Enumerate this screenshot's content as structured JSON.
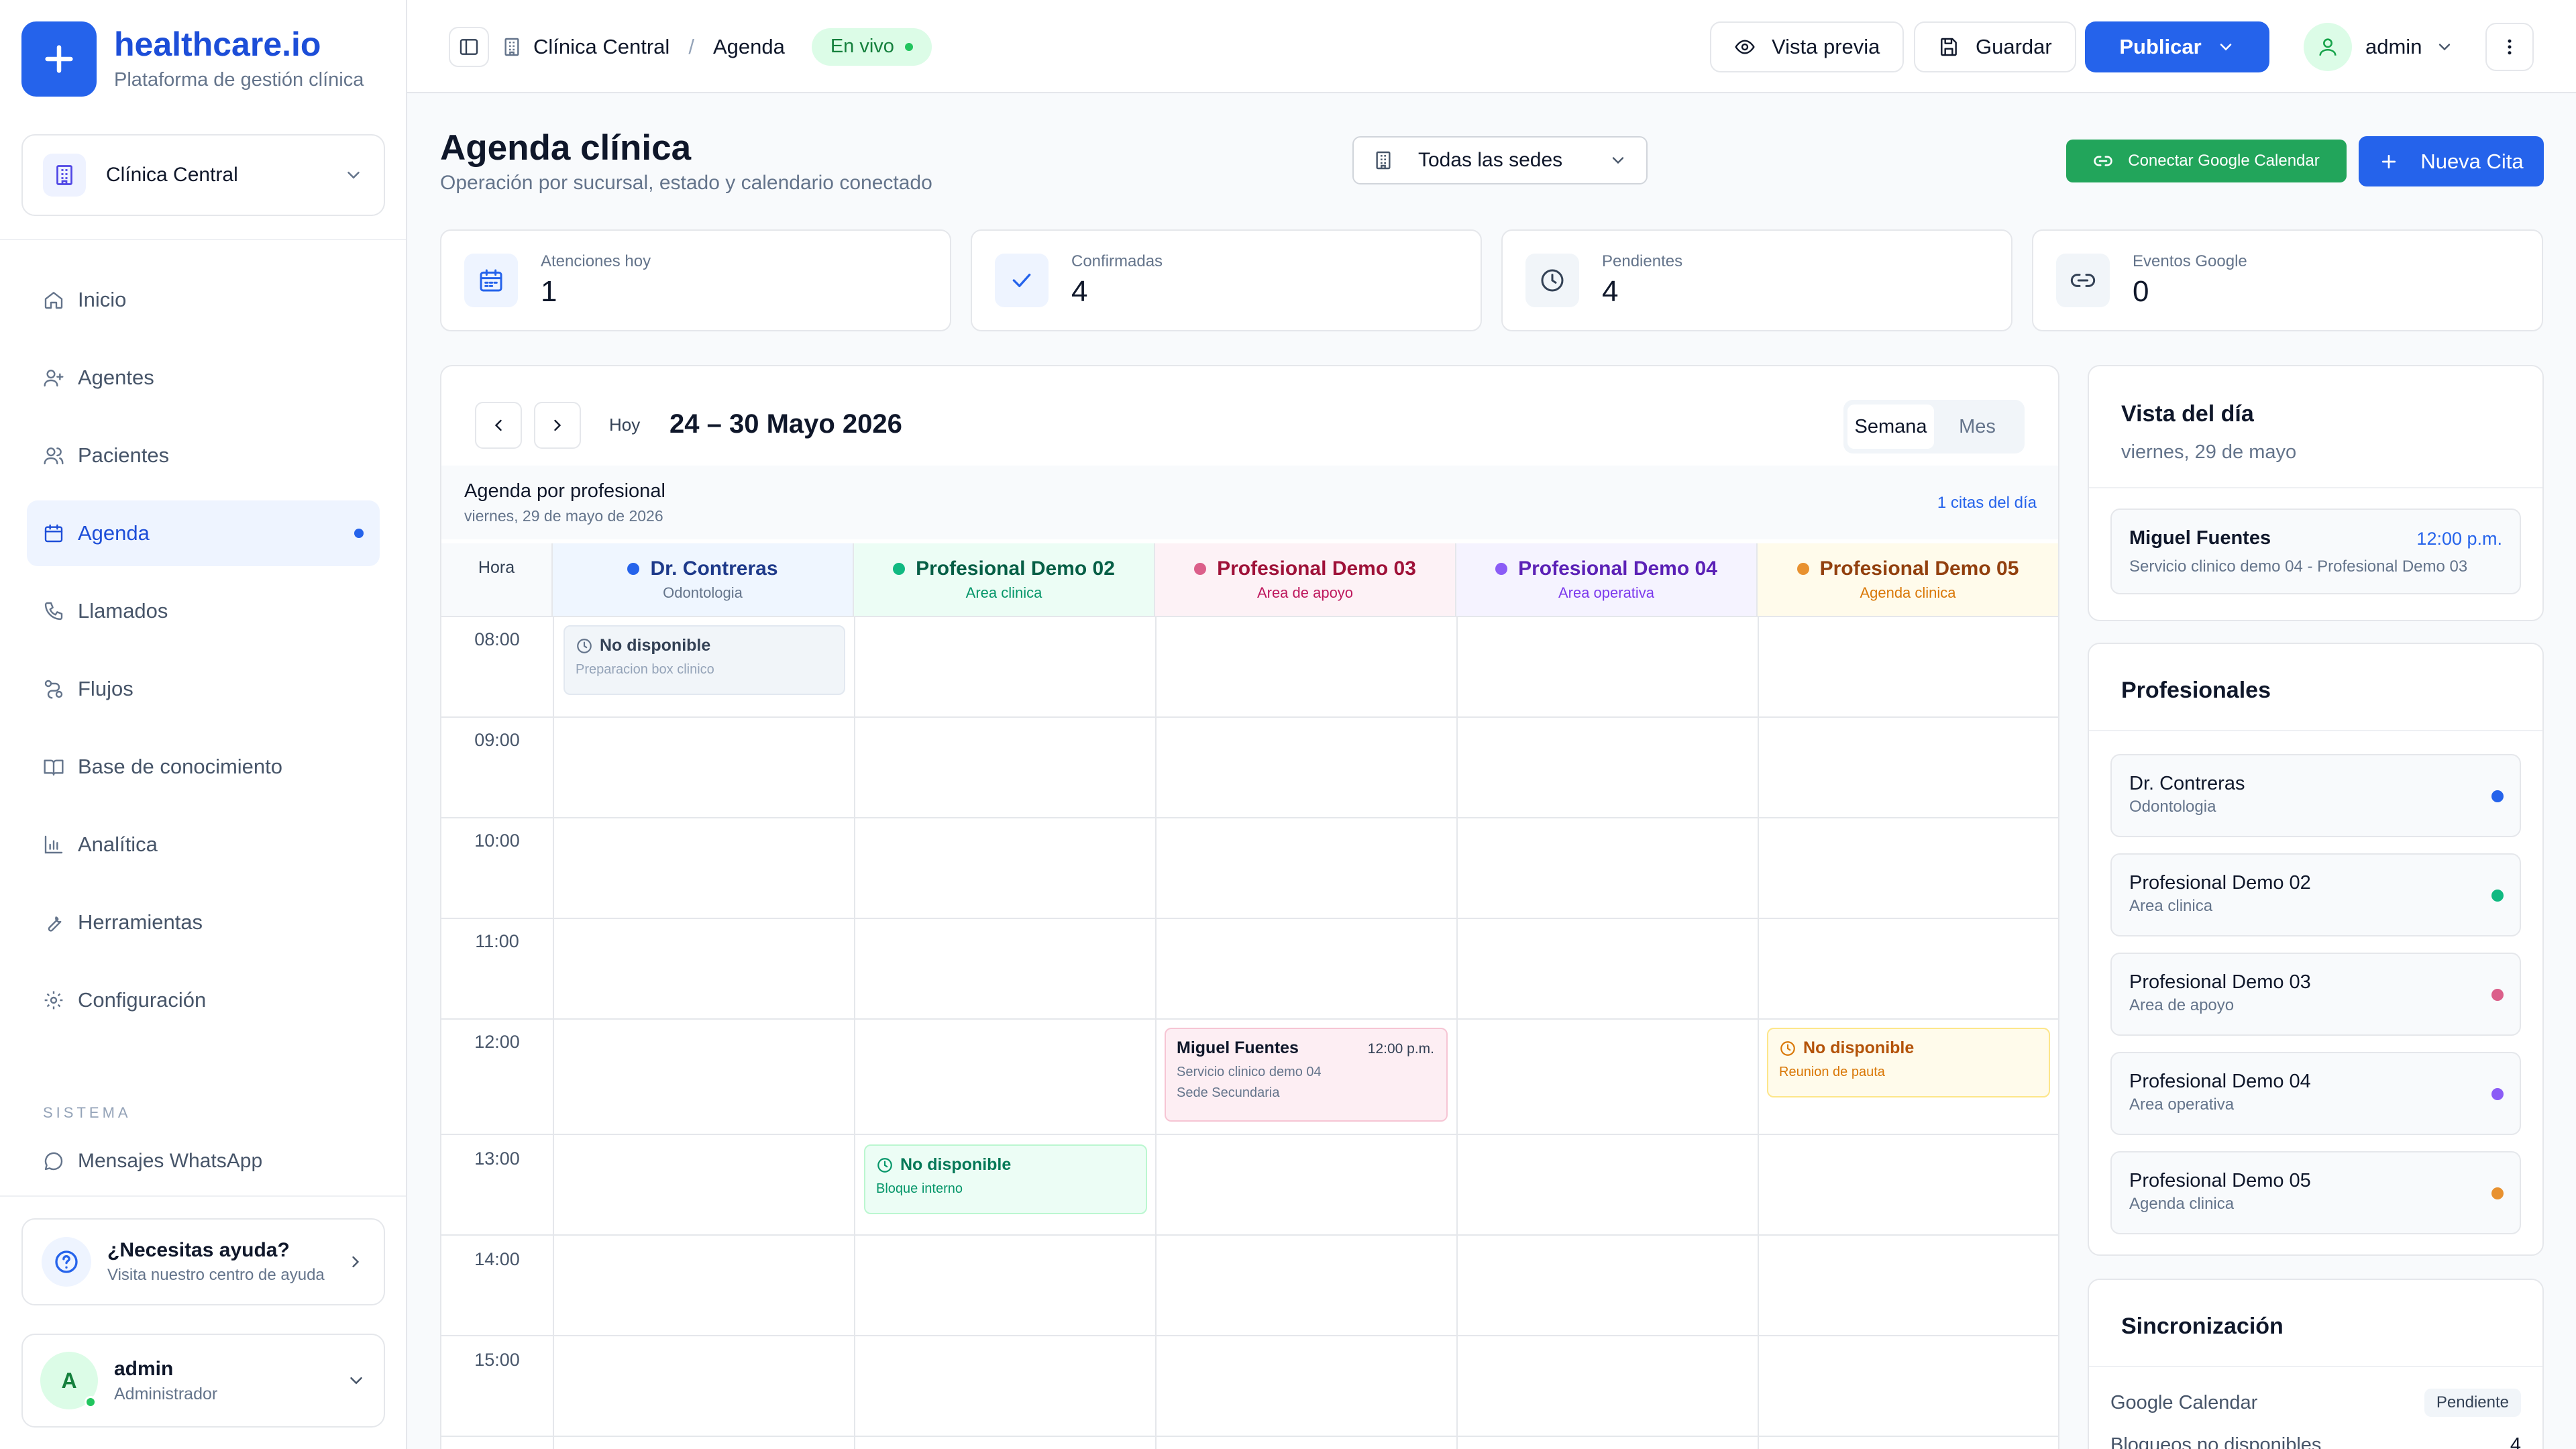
{
  "brand": {
    "name": "healthcare.io",
    "subtitle": "Plataforma de gestión clínica"
  },
  "clinic_selector": {
    "value": "Clínica Central"
  },
  "nav": {
    "items": [
      {
        "label": "Inicio",
        "icon": "home-icon"
      },
      {
        "label": "Agentes",
        "icon": "user-plus-icon"
      },
      {
        "label": "Pacientes",
        "icon": "users-icon"
      },
      {
        "label": "Agenda",
        "icon": "calendar-icon",
        "active": true
      },
      {
        "label": "Llamados",
        "icon": "phone-icon"
      },
      {
        "label": "Flujos",
        "icon": "workflow-icon"
      },
      {
        "label": "Base de conocimiento",
        "icon": "book-icon"
      },
      {
        "label": "Analítica",
        "icon": "bar-chart-icon"
      },
      {
        "label": "Herramientas",
        "icon": "wrench-icon"
      },
      {
        "label": "Configuración",
        "icon": "gear-icon"
      }
    ],
    "section_label": "SISTEMA",
    "system_item": "Mensajes WhatsApp"
  },
  "help": {
    "title": "¿Necesitas ayuda?",
    "subtitle": "Visita nuestro centro de ayuda"
  },
  "user": {
    "initial": "A",
    "name": "admin",
    "role": "Administrador"
  },
  "topbar": {
    "breadcrumb_clinic": "Clínica Central",
    "breadcrumb_separator": "/",
    "breadcrumb_page": "Agenda",
    "live_label": "En vivo",
    "preview_label": "Vista previa",
    "save_label": "Guardar",
    "publish_label": "Publicar",
    "user_label": "admin"
  },
  "header": {
    "title": "Agenda clínica",
    "subtitle": "Operación por sucursal, estado y calendario conectado",
    "sede_select": "Todas las sedes",
    "gcal_button": "Conectar Google Calendar",
    "new_button": "Nueva Cita"
  },
  "stats": [
    {
      "label": "Atenciones hoy",
      "value": "1"
    },
    {
      "label": "Confirmadas",
      "value": "4"
    },
    {
      "label": "Pendientes",
      "value": "4"
    },
    {
      "label": "Eventos Google",
      "value": "0"
    }
  ],
  "calendar": {
    "today_label": "Hoy",
    "range": "24 – 30 Mayo 2026",
    "view_week": "Semana",
    "view_month": "Mes",
    "agenda_title": "Agenda por profesional",
    "agenda_date": "viernes, 29 de mayo de 2026",
    "agenda_count": "1 citas del día",
    "hour_header": "Hora",
    "hours": [
      "08:00",
      "09:00",
      "10:00",
      "11:00",
      "12:00",
      "13:00",
      "14:00",
      "15:00"
    ],
    "columns": [
      {
        "name": "Dr. Contreras",
        "area": "Odontologia",
        "color": "#2563eb",
        "bg": "#eff6ff",
        "text": "#1e3a8a",
        "sub": "#64748b"
      },
      {
        "name": "Profesional Demo 02",
        "area": "Area clinica",
        "color": "#10b981",
        "bg": "#ecfdf5",
        "text": "#065f46",
        "sub": "#059669"
      },
      {
        "name": "Profesional Demo 03",
        "area": "Area de apoyo",
        "color": "#db5f8a",
        "bg": "#fdf2f6",
        "text": "#9f1239",
        "sub": "#be185d"
      },
      {
        "name": "Profesional Demo 04",
        "area": "Area operativa",
        "color": "#8b5cf6",
        "bg": "#f5f3ff",
        "text": "#5b21b6",
        "sub": "#7c3aed"
      },
      {
        "name": "Profesional Demo 05",
        "area": "Agenda clinica",
        "color": "#e8912f",
        "bg": "#fffbeb",
        "text": "#92400e",
        "sub": "#d97706"
      }
    ],
    "events": {
      "e1": {
        "title": "No disponible",
        "sub": "Preparacion box clinico"
      },
      "e2": {
        "title": "Miguel Fuentes",
        "time": "12:00 p.m.",
        "sub": "Servicio clinico demo 04",
        "sub2": "Sede Secundaria"
      },
      "e3": {
        "title": "No disponible",
        "sub": "Reunion de pauta"
      },
      "e4": {
        "title": "No disponible",
        "sub": "Bloque interno"
      }
    }
  },
  "day_view": {
    "title": "Vista del día",
    "date": "viernes, 29 de mayo",
    "item": {
      "name": "Miguel Fuentes",
      "time": "12:00 p.m.",
      "detail": "Servicio clinico demo 04 - Profesional Demo 03"
    }
  },
  "professionals": {
    "title": "Profesionales",
    "items": [
      {
        "name": "Dr. Contreras",
        "area": "Odontologia",
        "color": "#2563eb"
      },
      {
        "name": "Profesional Demo 02",
        "area": "Area clinica",
        "color": "#10b981"
      },
      {
        "name": "Profesional Demo 03",
        "area": "Area de apoyo",
        "color": "#db5f8a"
      },
      {
        "name": "Profesional Demo 04",
        "area": "Area operativa",
        "color": "#8b5cf6"
      },
      {
        "name": "Profesional Demo 05",
        "area": "Agenda clinica",
        "color": "#e8912f"
      }
    ]
  },
  "sync": {
    "title": "Sincronización",
    "google_label": "Google Calendar",
    "google_status": "Pendiente",
    "blocks_label": "Bloqueos no disponibles",
    "blocks_value": "4"
  }
}
